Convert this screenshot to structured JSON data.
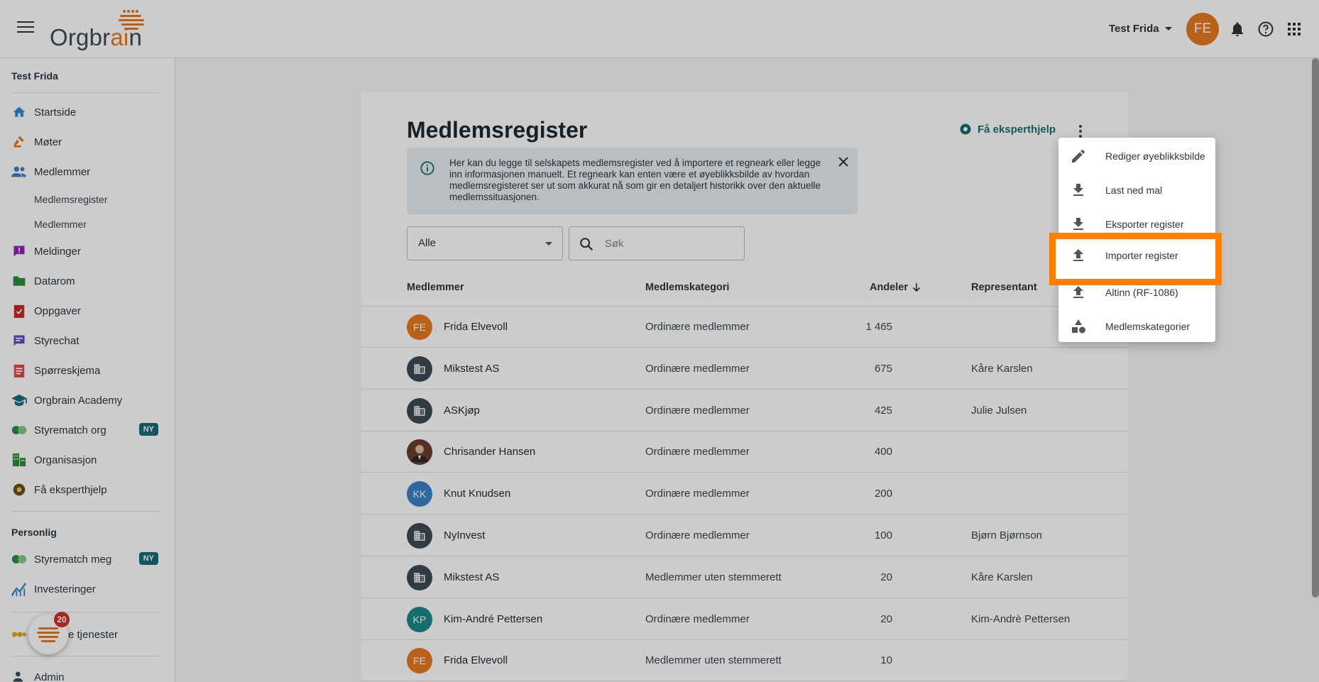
{
  "app": {
    "logo_text_a": "Orgbr",
    "logo_text_b": "ai",
    "logo_text_c": "n"
  },
  "topbar": {
    "user_name": "Test Frida",
    "avatar_initials": "FE"
  },
  "sidebar": {
    "org_name": "Test Frida",
    "items": [
      {
        "label": "Startside",
        "icon": "home-icon",
        "color": "#2a8bd1"
      },
      {
        "label": "Møter",
        "icon": "gavel-icon",
        "color": "#e87a1e"
      },
      {
        "label": "Medlemmer",
        "icon": "people-icon",
        "color": "#3b82c4"
      },
      {
        "label": "Meldinger",
        "icon": "message-alert-icon",
        "color": "#8e24aa"
      },
      {
        "label": "Datarom",
        "icon": "folder-icon",
        "color": "#2e8b3a"
      },
      {
        "label": "Oppgaver",
        "icon": "task-icon",
        "color": "#c62828"
      },
      {
        "label": "Styrechat",
        "icon": "chat-icon",
        "color": "#5b4bc4"
      },
      {
        "label": "Spørreskjema",
        "icon": "survey-icon",
        "color": "#e0464a"
      },
      {
        "label": "Orgbrain Academy",
        "icon": "academy-icon",
        "color": "#1a6b78"
      },
      {
        "label": "Styrematch org",
        "icon": "match-icon",
        "color": "#2e8b3a",
        "badge": "NY"
      },
      {
        "label": "Organisasjon",
        "icon": "organisation-icon",
        "color": "#2e8b3a"
      },
      {
        "label": "Få eksperthjelp",
        "icon": "expert-icon",
        "color": "#6d4c1f"
      }
    ],
    "sub_items": [
      "Medlemsregister",
      "Medlemmer"
    ],
    "personal_title": "Personlig",
    "personal_items": [
      {
        "label": "Styrematch meg",
        "icon": "match-icon",
        "badge": "NY"
      },
      {
        "label": "Investeringer",
        "icon": "chart-icon"
      }
    ],
    "services_label": "e tjenester",
    "admin_label": "Admin",
    "chat_badge_count": "20"
  },
  "main": {
    "title": "Medlemsregister",
    "expert_link": "Få eksperthjelp",
    "info_text": "Her kan du legge til selskapets medlemsregister ved å importere et regneark eller legge inn informasjonen manuelt. Et regneark kan enten være et øyeblikksbilde av hvordan medlemsregisteret ser ut som akkurat nå som gir en detaljert historikk over den aktuelle medlemssituasjonen.",
    "filter_value": "Alle",
    "search_placeholder": "Søk",
    "columns": {
      "members": "Medlemmer",
      "category": "Medlemskategori",
      "shares": "Andeler",
      "representative": "Representant"
    },
    "rows": [
      {
        "name": "Frida Elvevoll",
        "category": "Ordinære medlemmer",
        "shares": "1 465",
        "rep": "",
        "avatar": "FE",
        "avatar_type": "initials",
        "color": "#e87a1e"
      },
      {
        "name": "Mikstest AS",
        "category": "Ordinære medlemmer",
        "shares": "675",
        "rep": "Kåre Karslen",
        "avatar": "",
        "avatar_type": "building",
        "color": "#3d4a57"
      },
      {
        "name": "ASKjøp",
        "category": "Ordinære medlemmer",
        "shares": "425",
        "rep": "Julie Julsen",
        "avatar": "",
        "avatar_type": "building",
        "color": "#3d4a57"
      },
      {
        "name": "Chrisander Hansen",
        "category": "Ordinære medlemmer",
        "shares": "400",
        "rep": "",
        "avatar": "",
        "avatar_type": "photo",
        "color": "#7a4a3a"
      },
      {
        "name": "Knut Knudsen",
        "category": "Ordinære medlemmer",
        "shares": "200",
        "rep": "",
        "avatar": "KK",
        "avatar_type": "initials",
        "color": "#3b82c4"
      },
      {
        "name": "NyInvest",
        "category": "Ordinære medlemmer",
        "shares": "100",
        "rep": "Bjørn Bjørnson",
        "avatar": "",
        "avatar_type": "building",
        "color": "#3d4a57"
      },
      {
        "name": "Mikstest AS",
        "category": "Medlemmer uten stemmerett",
        "shares": "20",
        "rep": "Kåre Karslen",
        "avatar": "",
        "avatar_type": "building",
        "color": "#3d4a57"
      },
      {
        "name": "Kim-André Pettersen",
        "category": "Ordinære medlemmer",
        "shares": "20",
        "rep": "Kim-Andrè Pettersen",
        "avatar": "KP",
        "avatar_type": "initials",
        "color": "#1a8a8a"
      },
      {
        "name": "Frida Elvevoll",
        "category": "Medlemmer uten stemmerett",
        "shares": "10",
        "rep": "",
        "avatar": "FE",
        "avatar_type": "initials",
        "color": "#e87a1e"
      }
    ]
  },
  "menu": {
    "items": [
      {
        "label": "Rediger øyeblikksbilde",
        "icon": "pencil-icon"
      },
      {
        "label": "Last ned mal",
        "icon": "download-icon"
      },
      {
        "label": "Eksporter register",
        "icon": "download-icon"
      },
      {
        "label": "Importer register",
        "icon": "upload-icon",
        "highlighted": true
      },
      {
        "label": "Altinn (RF-1086)",
        "icon": "upload-icon"
      },
      {
        "label": "Medlemskategorier",
        "icon": "shapes-icon"
      }
    ],
    "highlight_color": "#ff8000"
  }
}
